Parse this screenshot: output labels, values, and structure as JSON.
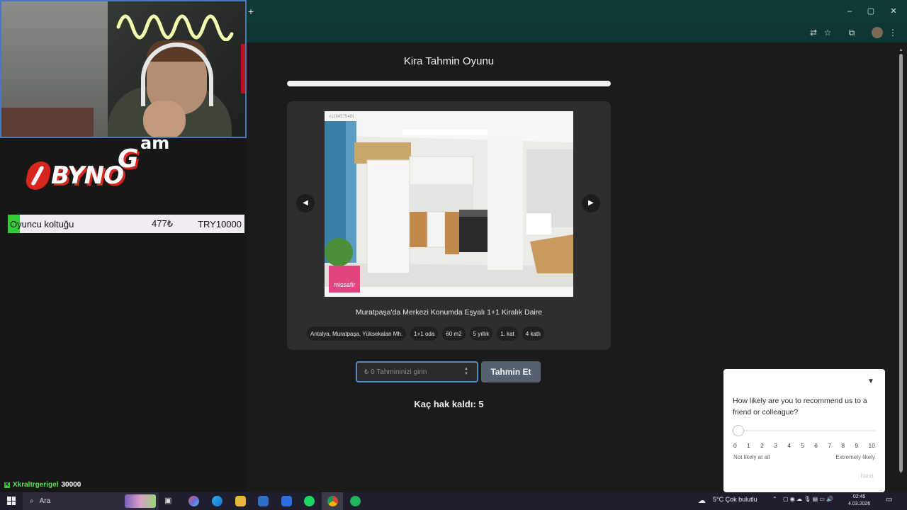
{
  "overlay": {
    "logo_text": "BYNO",
    "logo_g": "G",
    "logo_am": "am",
    "donation": {
      "name": "Oyuncu koltuğu",
      "price": "477₺",
      "amount": "TRY10000"
    },
    "chat": {
      "user": "Xkraltrgerigel",
      "amount": "30000"
    }
  },
  "browser": {
    "new_tab": "+",
    "window_buttons": {
      "minimize": "–",
      "maximize": "▢",
      "close": "✕"
    },
    "toolbar_icons": {
      "translate": "⇄",
      "star": "☆",
      "extensions": "⧉",
      "menu": "⋮"
    }
  },
  "game": {
    "title": "Kira Tahmin Oyunu",
    "progress_fraction": 1.0,
    "photo_id": "#1164575491",
    "watermark": "missafir",
    "prev_label": "◀",
    "next_label": "▶",
    "listing_title": "Muratpaşa'da Merkezi Konumda Eşyalı 1+1 Kiralık Daire",
    "tags": [
      "Antalya, Muratpaşa, Yüksekalan Mh.",
      "1+1 oda",
      "60 m2",
      "5 yıllık",
      "1. kat",
      "4 katlı"
    ],
    "input_placeholder": "₺ 0 Tahmininizi girin",
    "submit_label": "Tahmin Et",
    "tries_text": "Kaç hak kaldı: 5"
  },
  "survey": {
    "question": "How likely are you to recommend us to a friend or colleague?",
    "scale": [
      "0",
      "1",
      "2",
      "3",
      "4",
      "5",
      "6",
      "7",
      "8",
      "9",
      "10"
    ],
    "low_label": "Not likely at all",
    "high_label": "Extremely likely",
    "next_label": "Next"
  },
  "taskbar": {
    "search_text": "Ara",
    "weather": "5°C  Çok bulutlu",
    "time": "02:45",
    "date": "4.03.2026"
  },
  "colors": {
    "browser_frame": "#0f3b37",
    "page_bg": "#1b1b1b",
    "card_bg": "#2e2e2e",
    "input_border": "#4d8ad1",
    "button_bg": "#556170",
    "donation_accent": "#33cc33"
  }
}
